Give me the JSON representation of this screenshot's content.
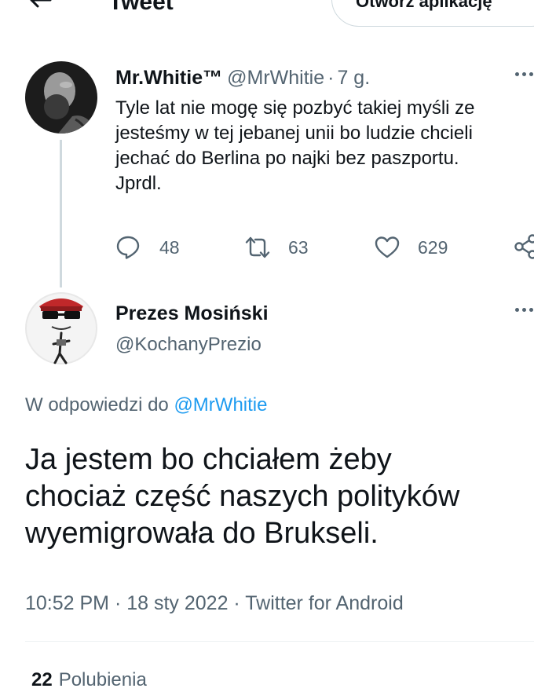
{
  "header": {
    "title": "Tweet",
    "open_app_label": "Otwórz aplikację"
  },
  "tweet1": {
    "name": "Mr.Whitie™",
    "handle": "@MrWhitie",
    "separator": "·",
    "time": "7 g.",
    "text": "Tyle lat nie mogę się pozbyć takiej myśli ze\njesteśmy w tej jebanej unii bo ludzie chcieli\njechać do Berlina po najki bez paszportu.\nJprdl.",
    "replies": "48",
    "retweets": "63",
    "likes": "629"
  },
  "tweet2": {
    "name": "Prezes Mosiński",
    "handle": "@KochanyPrezio",
    "reply_to_prefix": "W odpowiedzi do",
    "reply_to_handle": "@MrWhitie",
    "text": "Ja jestem bo chciałem żeby\nchociaż część naszych polityków\nwyemigrowała do Brukseli.",
    "meta": "10:52 PM · 18 sty 2022 · Twitter for Android",
    "likes_count": "22",
    "likes_label": "Polubienia"
  },
  "colors": {
    "text_primary": "#0f1419",
    "text_secondary": "#536471",
    "link": "#1d9bf0",
    "border": "#cfd9de"
  },
  "icons": [
    "back-arrow-icon",
    "more-icon",
    "reply-icon",
    "retweet-icon",
    "like-icon",
    "share-icon"
  ]
}
